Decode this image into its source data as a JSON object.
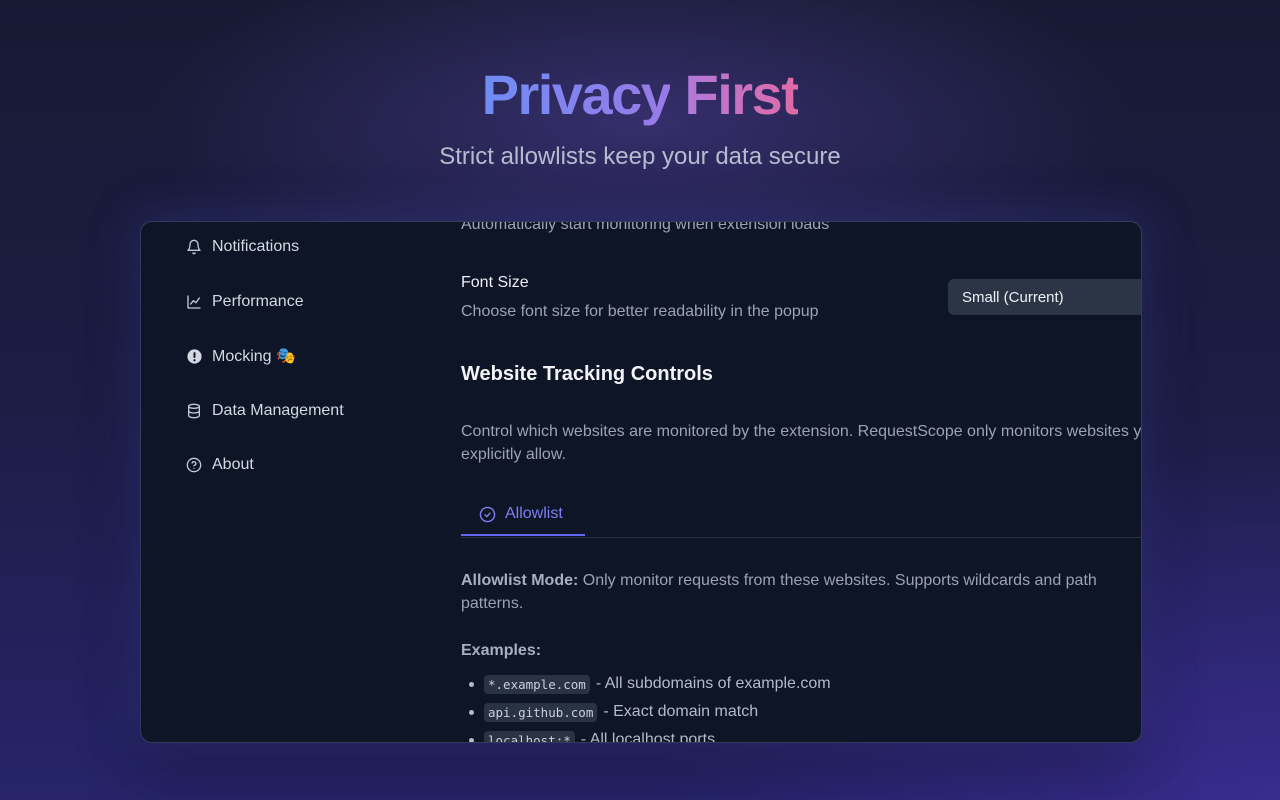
{
  "hero": {
    "title_word1": "Privacy",
    "title_word2": "First",
    "subtitle": "Strict allowlists keep your data secure"
  },
  "sidebar": {
    "items": [
      {
        "label": "Notifications",
        "icon": "bell-icon"
      },
      {
        "label": "Performance",
        "icon": "chart-icon"
      },
      {
        "label": "Mocking 🎭",
        "icon": "alert-circle-icon"
      },
      {
        "label": "Data Management",
        "icon": "database-icon"
      },
      {
        "label": "About",
        "icon": "help-circle-icon"
      }
    ]
  },
  "settings": {
    "autostart_description": "Automatically start monitoring when extension loads",
    "font_size": {
      "label": "Font Size",
      "description": "Choose font size for better readability in the popup",
      "selected": "Small (Current)"
    }
  },
  "tracking": {
    "title": "Website Tracking Controls",
    "description_line1": "Control which websites are monitored by the extension. RequestScope only monitors websites y",
    "description_line2": "explicitly allow.",
    "tab_label": "Allowlist",
    "mode_label": "Allowlist Mode:",
    "mode_text_line1": " Only monitor requests from these websites. Supports wildcards and path",
    "mode_text_line2": "patterns.",
    "examples_label": "Examples:",
    "examples": [
      {
        "code": "*.example.com",
        "text": " - All subdomains of example.com"
      },
      {
        "code": "api.github.com",
        "text": " - Exact domain match"
      },
      {
        "code": "localhost:*",
        "text": " - All localhost ports"
      }
    ]
  },
  "colors": {
    "accent": "#6366f1",
    "window_bg": "#0e1526",
    "select_bg": "#2b3546"
  }
}
